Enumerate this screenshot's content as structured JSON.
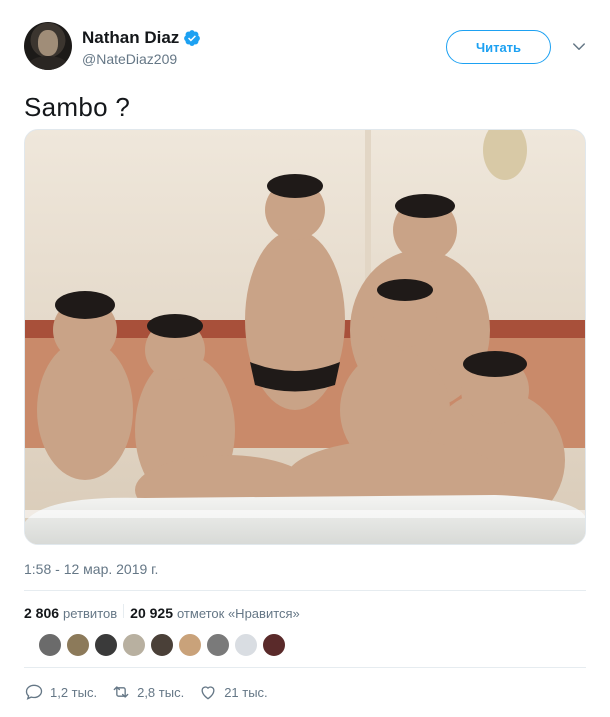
{
  "author": {
    "name": "Nathan Diaz",
    "handle": "@NateDiaz209",
    "verified": true,
    "follow_label": "Читать"
  },
  "tweet": {
    "text": "Sambo ?",
    "timestamp": "1:58 - 12 мар. 2019 г."
  },
  "stats": {
    "retweets_count": "2 806",
    "retweets_label": "ретвитов",
    "likes_count": "20 925",
    "likes_label": "отметок «Нравится»"
  },
  "likers": [
    "#6b6b6b",
    "#8c7a5a",
    "#3a3a3a",
    "#b8b0a0",
    "#4a4038",
    "#c9a27a",
    "#7a7a7a",
    "#d9dde2",
    "#5a2a2a"
  ],
  "actions": {
    "reply_count": "1,2 тыс.",
    "retweet_count": "2,8 тыс.",
    "like_count": "21 тыс."
  },
  "colors": {
    "accent": "#1da1f2",
    "secondary_text": "#657786",
    "primary_text": "#14171a"
  }
}
